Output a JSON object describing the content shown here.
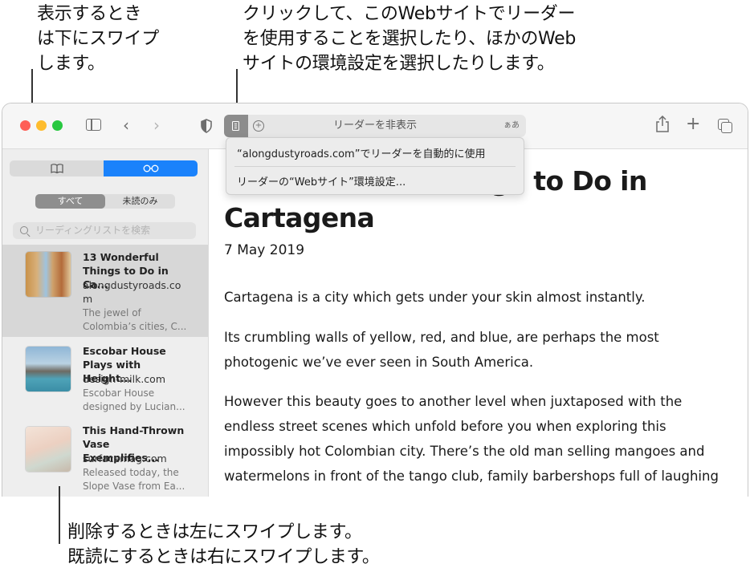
{
  "callouts": {
    "swipe_show": "表示するとき\nは下にスワイプ\nします。",
    "reader_click": "クリックして、このWebサイトでリーダー\nを使用することを選択したり、ほかのWeb\nサイトの環境設定を選択したりします。",
    "swipe_delete": "削除するときは左にスワイプします。",
    "swipe_read": "既読にするときは右にスワイプします。"
  },
  "toolbar": {
    "address_text": "リーダーを非表示",
    "text_size_label": "ぁあ",
    "colors": {
      "close": "#fe5f57",
      "minimize": "#febc2e",
      "zoom": "#28c840"
    }
  },
  "reader_menu": {
    "items": [
      "“alongdustyroads.com”でリーダーを自動的に使用",
      "リーダーの“Webサイト”環境設定..."
    ]
  },
  "sidebar": {
    "filters": [
      "すべて",
      "未読のみ"
    ],
    "search_placeholder": "リーディングリストを検索",
    "accent": "#1a82fb",
    "items": [
      {
        "title1": "13 Wonderful",
        "title2": "Things to Do in Ca...",
        "domain1": "alongdustyroads.co",
        "domain2": "m",
        "excerpt1": "The jewel of",
        "excerpt2": "Colombia’s cities, C..."
      },
      {
        "title1": "Escobar House",
        "title2": "Plays with Height...",
        "domain1": "design-milk.com",
        "excerpt1": "Escobar House",
        "excerpt2": "designed by Lucian..."
      },
      {
        "title1": "This Hand-Thrown",
        "title2": "Vase Exemplifies...",
        "domain1": "surfacemag.com",
        "excerpt1": "Released today, the",
        "excerpt2": "Slope Vase from Ea..."
      }
    ]
  },
  "article": {
    "title_line1": "13 Wonderful Things to Do in",
    "title_line2": "Cartagena",
    "date": "7 May 2019",
    "p1": "Cartagena is a city which gets under your skin almost instantly.",
    "p2_l1": "Its crumbling walls of yellow, red, and blue, are perhaps the most",
    "p2_l2": "photogenic we’ve ever seen in South America.",
    "p3_l1": "However this beauty goes to another level when juxtaposed with the",
    "p3_l2": "endless street scenes which unfold before you when exploring this",
    "p3_l3": "impossibly hot Colombian city. There’s the old man selling mangoes and",
    "p3_l4": "watermelons in front of the tango club, family barbershops full of laughing"
  }
}
